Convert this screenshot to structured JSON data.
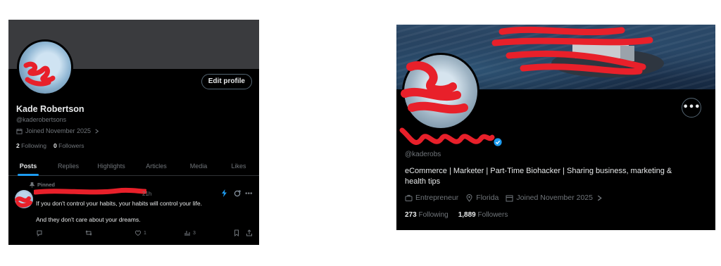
{
  "left": {
    "edit_profile": "Edit profile",
    "name": "Kade Robertson",
    "handle": "@kaderobertsons",
    "joined": "Joined November 2025",
    "following_count": "2",
    "following_label": "Following",
    "followers_count": "0",
    "followers_label": "Followers",
    "tabs": [
      "Posts",
      "Replies",
      "Highlights",
      "Articles",
      "Media",
      "Likes"
    ],
    "active_tab": "Posts",
    "post": {
      "pinned_label": "Pinned",
      "time": "21h",
      "text_line1": "If you don't control your habits, your habits will control your life.",
      "text_line2": "And they don't care about your dreams.",
      "likes": "1",
      "views": "3"
    }
  },
  "right": {
    "more_label": "•••",
    "handle": "@kaderobs",
    "bio": "eCommerce | Marketer | Part-Time Biohacker | Sharing business, marketing & health tips",
    "category": "Entrepreneur",
    "location": "Florida",
    "joined": "Joined November 2025",
    "following_count": "273",
    "following_label": "Following",
    "followers_count": "1,889",
    "followers_label": "Followers"
  },
  "colors": {
    "background": "#000000",
    "text_primary": "#e7e9ea",
    "text_secondary": "#71767b",
    "accent_blue": "#1d9bf0",
    "redaction_red": "#e8202a"
  },
  "icons": [
    "calendar-icon",
    "chevron-right-icon",
    "pin-icon",
    "grok-icon",
    "more-icon",
    "reply-icon",
    "repost-icon",
    "like-icon",
    "views-icon",
    "bookmark-icon",
    "share-icon",
    "verified-badge-icon",
    "briefcase-icon",
    "location-pin-icon"
  ]
}
